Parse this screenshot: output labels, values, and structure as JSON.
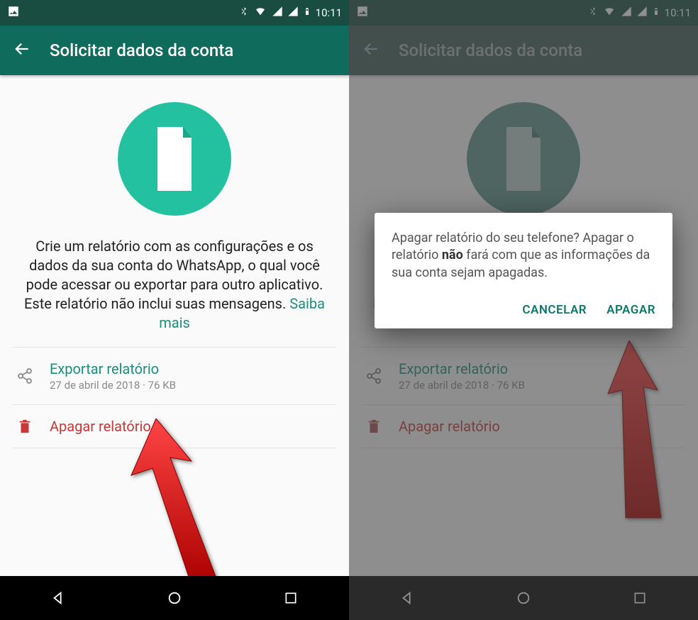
{
  "statusbar": {
    "time": "10:11"
  },
  "appbar": {
    "title": "Solicitar dados da conta"
  },
  "body": {
    "text": "Crie um relatório com as configurações e os dados da sua conta do WhatsApp, o qual você pode acessar ou exportar para outro aplicativo. Este relatório não inclui suas mensagens.",
    "link": "Saiba mais"
  },
  "rows": {
    "export": {
      "label": "Exportar relatório",
      "meta": "27 de abril de 2018 · 76 KB"
    },
    "delete": {
      "label": "Apagar relatório"
    }
  },
  "dialog": {
    "text_before": "Apagar relatório do seu telefone? Apagar o relatório ",
    "bold": "não",
    "text_after": " fará com que as informações da sua conta sejam apagadas.",
    "cancel": "CANCELAR",
    "confirm": "APAGAR"
  },
  "colors": {
    "accent": "#0f6b5c",
    "teal_circle": "#24c1a1",
    "link_green": "#1a8f7b",
    "danger": "#c83838"
  }
}
